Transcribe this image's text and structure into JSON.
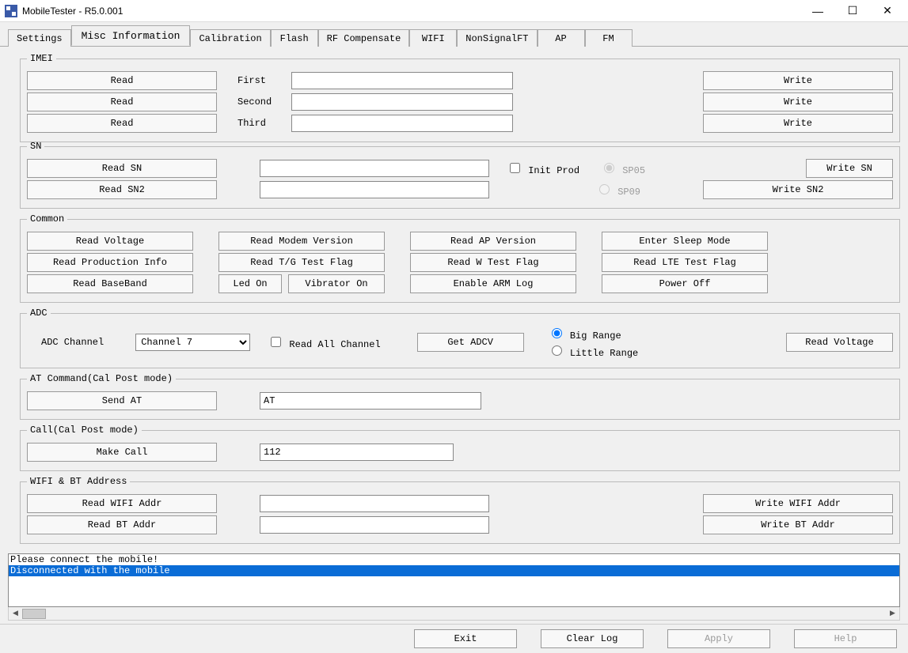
{
  "window": {
    "title": "MobileTester - R5.0.001",
    "minimize": "—",
    "maximize": "☐",
    "close": "✕"
  },
  "tabs": {
    "settings": "Settings",
    "misc": "Misc Information",
    "calibration": "Calibration",
    "flash": "Flash",
    "rf": "RF Compensate",
    "wifi": "WIFI",
    "nonsig": "NonSignalFT",
    "ap": "AP",
    "fm": "FM"
  },
  "imei": {
    "legend": "IMEI",
    "read": "Read",
    "write": "Write",
    "first_label": "First",
    "second_label": "Second",
    "third_label": "Third",
    "first_val": "",
    "second_val": "",
    "third_val": ""
  },
  "sn": {
    "legend": "SN",
    "read_sn": "Read SN",
    "read_sn2": "Read SN2",
    "write_sn": "Write SN",
    "write_sn2": "Write SN2",
    "sn_val": "",
    "sn2_val": "",
    "init_prod": "Init Prod",
    "sp05": "SP05",
    "sp09": "SP09"
  },
  "common": {
    "legend": "Common",
    "read_voltage": "Read Voltage",
    "read_modem_version": "Read Modem Version",
    "read_ap_version": "Read AP Version",
    "enter_sleep_mode": "Enter Sleep Mode",
    "read_production_info": "Read Production Info",
    "read_tg_test_flag": "Read T/G Test Flag",
    "read_w_test_flag": "Read W Test Flag",
    "read_lte_test_flag": "Read LTE Test Flag",
    "read_baseband": "Read BaseBand",
    "led_on": "Led On",
    "vibrator_on": "Vibrator On",
    "enable_arm_log": "Enable ARM Log",
    "power_off": "Power Off"
  },
  "adc": {
    "legend": "ADC",
    "adc_channel_label": "ADC Channel",
    "channel_value": "Channel 7",
    "read_all_channel": "Read All Channel",
    "get_adcv": "Get ADCV",
    "big_range": "Big Range",
    "little_range": "Little Range",
    "read_voltage": "Read Voltage"
  },
  "at": {
    "legend": "AT Command(Cal Post mode)",
    "send_at": "Send AT",
    "at_value": "AT"
  },
  "call": {
    "legend": "Call(Cal Post mode)",
    "make_call": "Make Call",
    "number": "112"
  },
  "wifi": {
    "legend": "WIFI & BT Address",
    "read_wifi_addr": "Read WIFI Addr",
    "write_wifi_addr": "Write WIFI Addr",
    "read_bt_addr": "Read BT   Addr",
    "write_bt_addr": "Write BT   Addr",
    "wifi_val": "",
    "bt_val": ""
  },
  "log": {
    "line1": "Please connect the mobile!",
    "line2": "Disconnected with the mobile"
  },
  "bottom": {
    "exit": "Exit",
    "clear_log": "Clear Log",
    "apply": "Apply",
    "help": "Help"
  }
}
